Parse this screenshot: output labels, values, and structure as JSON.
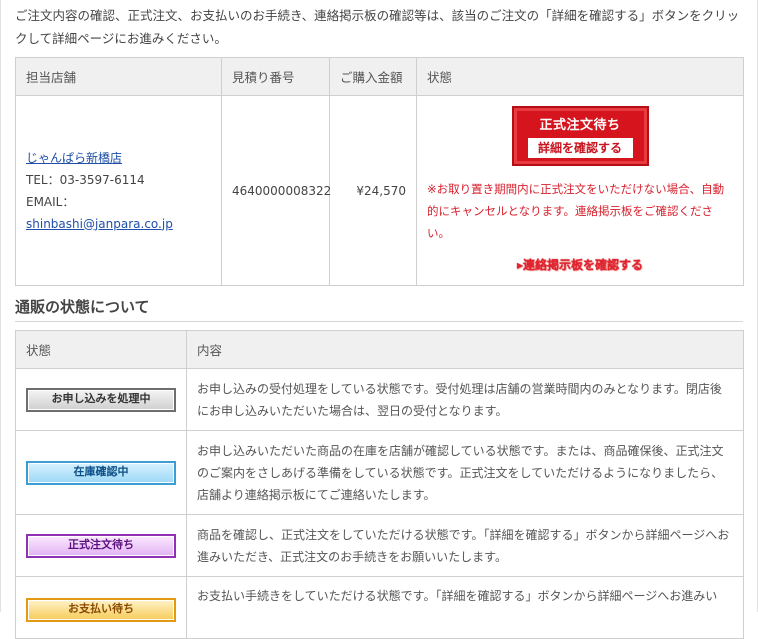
{
  "intro_text": "ご注文内容の確認、正式注文、お支払いのお手続き、連絡掲示板の確認等は、該当のご注文の「詳細を確認する」ボタンをクリックして詳細ページにお進みください。",
  "order_table": {
    "headers": [
      "担当店舗",
      "見積り番号",
      "ご購入金額",
      "状態"
    ],
    "row": {
      "shop_name": "じゃんぱら新橋店",
      "tel": "TEL：03-3597-6114",
      "email_label": "EMAIL：",
      "email": "shinbashi@janpara.co.jp",
      "quote_number": "4640000008322",
      "amount": "¥24,570",
      "status_badge_title": "正式注文待ち",
      "status_badge_button": "詳細を確認する",
      "warning": "※お取り置き期間内に正式注文をいただけない場合、自動的にキャンセルとなります。連絡掲示板をご確認ください。",
      "board_link": "連絡掲示板を確認する"
    }
  },
  "section_title": "通販の状態について",
  "status_table": {
    "headers": [
      "状態",
      "内容"
    ],
    "rows": [
      {
        "label": "お申し込みを処理中",
        "description": "お申し込みの受付処理をしている状態です。受付処理は店舗の営業時間内のみとなります。閉店後にお申し込みいただいた場合は、翌日の受付となります。"
      },
      {
        "label": "在庫確認中",
        "description": "お申し込みいただいた商品の在庫を店舗が確認している状態です。または、商品確保後、正式注文のご案内をさしあげる準備をしている状態です。正式注文をしていただけるようになりましたら、店舗より連絡掲示板にてご連絡いたします。"
      },
      {
        "label": "正式注文待ち",
        "description": "商品を確認し、正式注文をしていただける状態です。「詳細を確認する」ボタンから詳細ページへお進みいただき、正式注文のお手続きをお願いいたします。"
      },
      {
        "label": "お支払い待ち",
        "description": "お支払い手続きをしていただける状態です。「詳細を確認する」ボタンから詳細ページへお進みい"
      }
    ]
  },
  "colors": {
    "accent_red": "#d5141e",
    "link_blue": "#1f4fa8",
    "state_gray": "#6e6e6e",
    "state_blue": "#3a9ed5",
    "state_purple": "#9031b5",
    "state_orange": "#e39a13"
  }
}
